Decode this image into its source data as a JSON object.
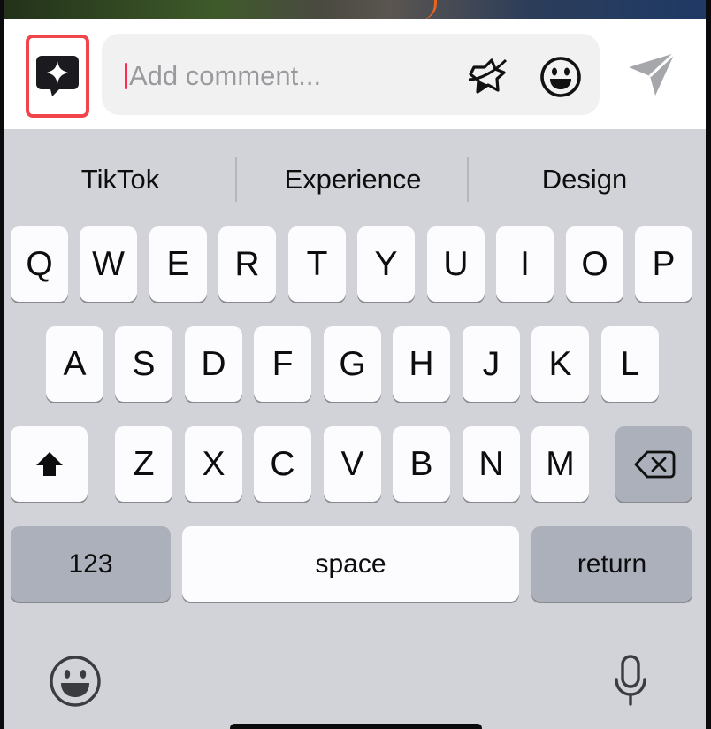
{
  "comment_bar": {
    "ai_button_icon": "ai-sparkle-chat-icon",
    "input_placeholder": "Add comment...",
    "sticker_icon": "sticker-icon",
    "emoji_icon": "emoji-icon",
    "send_icon": "send-icon",
    "accent_color": "#f0454b",
    "caret_color": "#fe2c55"
  },
  "suggestions": [
    "TikTok",
    "Experience",
    "Design"
  ],
  "keyboard": {
    "row1": [
      "Q",
      "W",
      "E",
      "R",
      "T",
      "Y",
      "U",
      "I",
      "O",
      "P"
    ],
    "row2": [
      "A",
      "S",
      "D",
      "F",
      "G",
      "H",
      "J",
      "K",
      "L"
    ],
    "row3": [
      "Z",
      "X",
      "C",
      "V",
      "B",
      "N",
      "M"
    ],
    "shift_icon": "shift-icon",
    "delete_icon": "delete-icon",
    "numbers_label": "123",
    "space_label": "space",
    "return_label": "return",
    "emoji_keyboard_icon": "emoji-keyboard-icon",
    "dictation_icon": "microphone-icon"
  }
}
